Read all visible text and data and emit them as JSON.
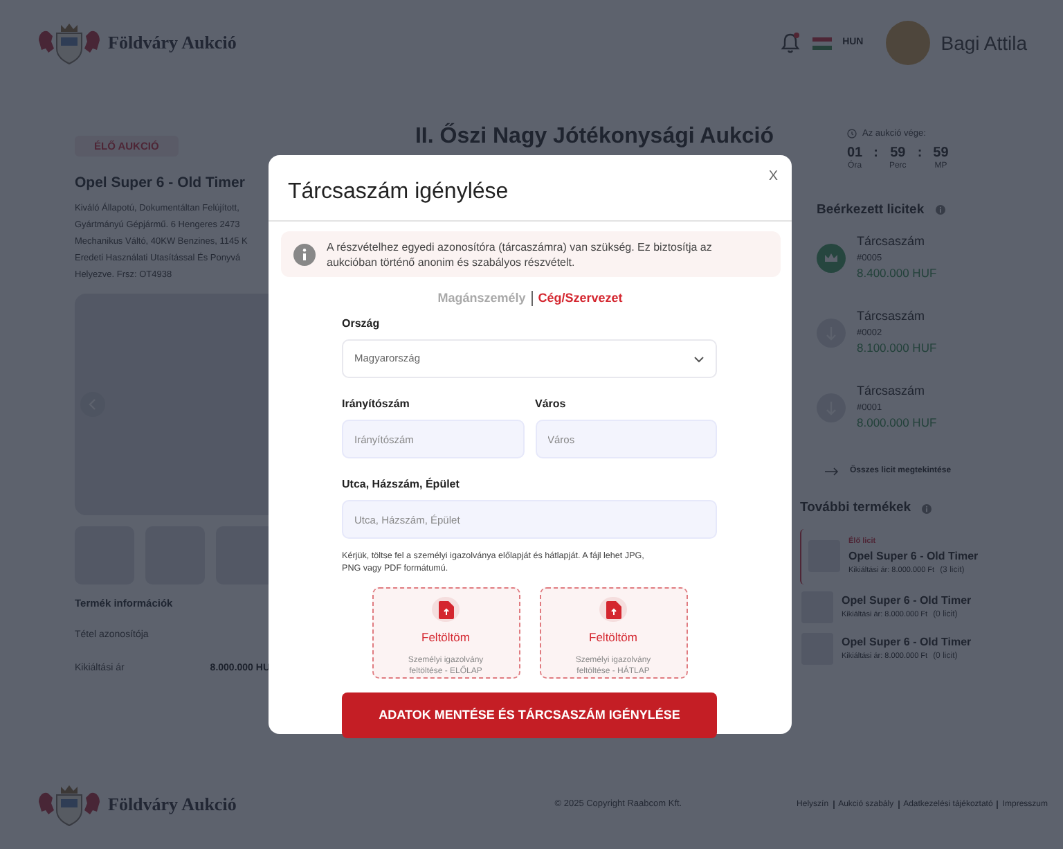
{
  "header": {
    "logo_text": "Földváry Aukció",
    "notification_unread": true,
    "language": "HUN",
    "user_name": "Bagi Attila"
  },
  "product": {
    "status_badge": "ÉLŐ AUKCIÓ",
    "title": "Opel Super 6 - Old Timer",
    "description_lines": [
      "Kiváló Állapotú, Dokumentáltan Felújított,",
      "Gyártmányú Gépjármű. 6 Hengeres 2473",
      "Mechanikus Váltó, 40KW Benzines, 1145 K",
      "Eredeti Használati Utasítással És Ponyvá",
      "Helyezve. Frsz: OT4938"
    ],
    "thumbnails": [
      {
        "kind": "placeholder"
      },
      {
        "kind": "placeholder"
      },
      {
        "kind": "placeholder"
      }
    ],
    "info_title": "Termék információk",
    "info_rows": [
      {
        "label": "Tétel azonosítója"
      },
      {
        "label": "Kikiáltási ár",
        "value": "8.000.000 HU"
      }
    ]
  },
  "auction": {
    "title": "II. Őszi Nagy Jótékonysági Aukció",
    "countdown_label": "Az aukció vége:",
    "countdown_separator": ":",
    "countdown": [
      {
        "value": "01",
        "unit": "Óra"
      },
      {
        "value": "59",
        "unit": "Perc"
      },
      {
        "value": "59",
        "unit": "MP"
      }
    ]
  },
  "bids": {
    "title": "Beérkezett licitek",
    "items": [
      {
        "name": "Tárcsaszám",
        "number": "#0005",
        "amount": "8.400.000 HUF",
        "leading": true
      },
      {
        "name": "Tárcsaszám",
        "number": "#0002",
        "amount": "8.100.000 HUF",
        "leading": false
      },
      {
        "name": "Tárcsaszám",
        "number": "#0001",
        "amount": "8.000.000 HUF",
        "leading": false
      }
    ],
    "view_all": "Összes licit megtekintése"
  },
  "more_products": {
    "title": "További termékek",
    "items": [
      {
        "live_label": "Élő licit",
        "title": "Opel Super 6 - Old Timer",
        "price": "Kikiáltási ár: 8.000.000 Ft",
        "bid_count": "(3 licit)",
        "selected": true
      },
      {
        "title": "Opel Super 6 - Old Timer",
        "price": "Kikiáltási ár: 8.000.000 Ft",
        "bid_count": "(0 licit)",
        "selected": false
      },
      {
        "title": "Opel Super 6 - Old Timer",
        "price": "Kikiáltási ár: 8.000.000 Ft",
        "bid_count": "(0 licit)",
        "selected": false
      }
    ]
  },
  "footer": {
    "logo_text": "Földváry Aukció",
    "copyright": "© 2025 Copyright Raabcom Kft.",
    "links": [
      "Helyszín",
      "Aukció szabály",
      "Adatkezelési tájékoztató",
      "Impresszum"
    ]
  },
  "modal": {
    "title": "Tárcsaszám igénylése",
    "close": "X",
    "notice": "A részvételhez egyedi azonosítóra (tárcaszámra) van szükség. Ez biztosítja az aukcióban történő anonim és szabályos részvételt.",
    "tabs": [
      {
        "label": "Magánszemély",
        "selected": false
      },
      {
        "label": "Cég/Szervezet",
        "selected": true
      }
    ],
    "field_rows": [
      [
        {
          "kind": "select",
          "label": "Ország",
          "value": "Magyarország"
        }
      ],
      [
        {
          "kind": "text",
          "label": "Irányítószám",
          "placeholder": "Irányítószám"
        },
        {
          "kind": "text",
          "label": "Város",
          "placeholder": "Város"
        }
      ],
      [
        {
          "kind": "text",
          "label": "Utca, Házszám, Épület",
          "placeholder": "Utca, Házszám, Épület"
        }
      ]
    ],
    "upload_hint": "Kérjük, töltse fel a személyi igazolványa előlapját és hátlapját. A fájl lehet JPG, PNG vagy PDF formátumú.",
    "uploads": [
      {
        "label": "Feltöltöm",
        "caption": "Személyi igazolvány feltöltése - ELŐLAP"
      },
      {
        "label": "Feltöltöm",
        "caption": "Személyi igazolvány feltöltése - HÁTLAP"
      }
    ],
    "submit": "ADATOK MENTÉSE ÉS TÁRCSASZÁM IGÉNYLÉSE"
  }
}
